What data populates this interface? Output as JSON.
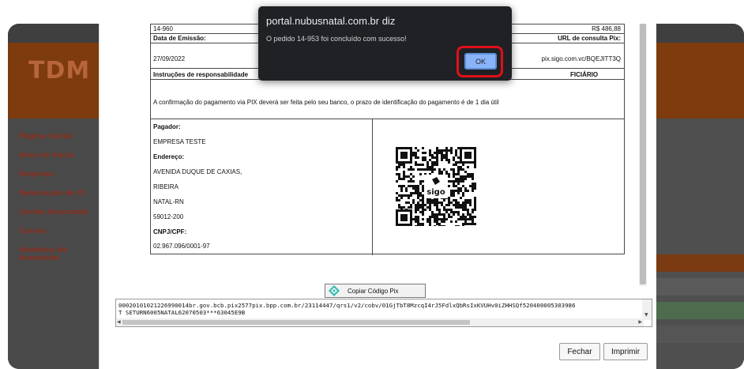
{
  "background": {
    "app_logo": "TDM",
    "sidebar_items": [
      "Página Inicial",
      "Área do Sócio",
      "Empresa",
      "Renovação do CI",
      "Cartão Associado",
      "Cursos",
      "Histórico do Associado"
    ]
  },
  "document": {
    "order_number": "14-960",
    "amount": "R$ 486,88",
    "issue_date_label": "Data de Emissão:",
    "issue_date": "27/09/2022",
    "pix_url_label": "URL de consulta Pix:",
    "pix_url": "pix.sigo.com.vc/BQEJITT3Q",
    "instructions_label": "Instruções de responsabilidade",
    "beneficiary_fragment": "FICIÁRIO",
    "instructions_text": "A confirmação do pagamento via PIX deverá ser feita pelo seu banco, o prazo de identificação do pagamento é de 1 dia útil",
    "payer_label": "Pagador:",
    "payer_name": "EMPRESA TESTE",
    "address_label": "Endereço:",
    "address_line1": "AVENIDA DUQUE DE CAXIAS,",
    "address_line2": "RIBEIRA",
    "address_city": "NATAL-RN",
    "address_zip": "59012-200",
    "cnpj_label": "CNPJ/CPF:",
    "cnpj_value": "02.967.096/0001-97",
    "qr_brand": "sigo"
  },
  "pix": {
    "copy_button_label": "Copiar Código Pix",
    "code_line1": "00020101021226990014br.gov.bcb.pix2577pix.bpp.com.br/23114447/qrs1/v2/cobv/01GjTbT8MzcqI4rJ5FdlxQbRsIxKVUHv0iZHHSQf520400005303986",
    "code_line2": "T SETURN6005NATAL62070503***63045E9B"
  },
  "footer": {
    "close_label": "Fechar",
    "print_label": "Imprimir"
  },
  "alert": {
    "title": "portal.nubusnatal.com.br diz",
    "message": "O pedido 14-953 foi concluído com sucesso!",
    "ok_label": "OK"
  }
}
